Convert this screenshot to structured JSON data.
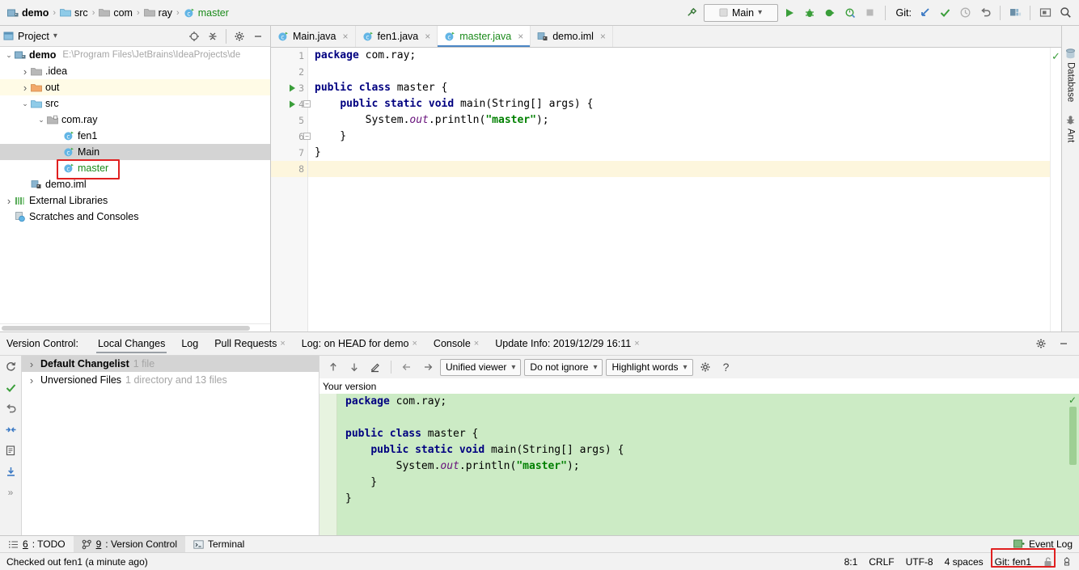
{
  "toolbar": {
    "breadcrumb": [
      {
        "label": "demo",
        "icon": "project-icon",
        "style": "bold"
      },
      {
        "label": "src",
        "icon": "folder-blue-icon",
        "style": "normal"
      },
      {
        "label": "com",
        "icon": "folder-gray-icon",
        "style": "normal"
      },
      {
        "label": "ray",
        "icon": "folder-gray-icon",
        "style": "normal"
      },
      {
        "label": "master",
        "icon": "java-class-icon",
        "style": "green"
      }
    ],
    "separator": "›",
    "run_config": "Main",
    "run_config_arrow": "⌄",
    "git_label": "Git:",
    "buttons": [
      "build-hammer-icon",
      "run-icon",
      "debug-icon",
      "run-coverage-icon",
      "profile-icon",
      "stop-icon",
      "git-update-icon",
      "git-commit-icon",
      "git-history-icon",
      "git-rollback-icon",
      "project-structure-icon",
      "present-mode-icon",
      "search-everywhere-icon"
    ]
  },
  "project_panel": {
    "title": "Project",
    "title_arrow": "▾",
    "tools": [
      "locate-icon",
      "collapse-all-icon",
      "settings-gear-icon",
      "hide-icon"
    ],
    "tree": [
      {
        "depth": 0,
        "twist": "⌄",
        "icon": "project-icon",
        "label": "demo",
        "style": "bold",
        "path": "E:\\Program Files\\JetBrains\\IdeaProjects\\de",
        "state": "normal"
      },
      {
        "depth": 1,
        "twist": "›",
        "icon": "folder-gray-icon",
        "label": ".idea",
        "style": "normal",
        "path": "",
        "state": "normal"
      },
      {
        "depth": 1,
        "twist": "›",
        "icon": "folder-orange-icon",
        "label": "out",
        "style": "normal",
        "path": "",
        "state": "band"
      },
      {
        "depth": 1,
        "twist": "⌄",
        "icon": "folder-blue-icon",
        "label": "src",
        "style": "normal",
        "path": "",
        "state": "normal"
      },
      {
        "depth": 2,
        "twist": "⌄",
        "icon": "package-icon",
        "label": "com.ray",
        "style": "normal",
        "path": "",
        "state": "normal"
      },
      {
        "depth": 3,
        "twist": "",
        "icon": "java-class-icon",
        "label": "fen1",
        "style": "normal",
        "path": "",
        "state": "normal"
      },
      {
        "depth": 3,
        "twist": "",
        "icon": "java-class-icon",
        "label": "Main",
        "style": "normal",
        "path": "",
        "state": "selected"
      },
      {
        "depth": 3,
        "twist": "",
        "icon": "java-class-icon",
        "label": "master",
        "style": "green",
        "path": "",
        "state": "highlighted"
      },
      {
        "depth": 1,
        "twist": "",
        "icon": "iml-file-icon",
        "label": "demo.iml",
        "style": "normal",
        "path": "",
        "state": "normal"
      },
      {
        "depth": 0,
        "twist": "›",
        "icon": "external-libraries-icon",
        "label": "External Libraries",
        "style": "normal",
        "path": "",
        "state": "normal"
      },
      {
        "depth": 0,
        "twist": "",
        "icon": "scratches-icon",
        "label": "Scratches and Consoles",
        "style": "normal",
        "path": "",
        "state": "normal"
      }
    ]
  },
  "editor_tabs": [
    {
      "label": "Main.java",
      "icon": "java-class-icon",
      "active": false,
      "color": "normal"
    },
    {
      "label": "fen1.java",
      "icon": "java-class-icon",
      "active": false,
      "color": "normal"
    },
    {
      "label": "master.java",
      "icon": "java-class-icon",
      "active": true,
      "color": "green"
    },
    {
      "label": "demo.iml",
      "icon": "iml-file-icon",
      "active": false,
      "color": "normal"
    }
  ],
  "editor_tab_close": "×",
  "editor": {
    "line_numbers": [
      "1",
      "2",
      "3",
      "4",
      "5",
      "6",
      "7",
      "8"
    ],
    "current_line": 8,
    "run_arrow_lines": [
      3,
      4
    ],
    "fold_lines": [
      4,
      6
    ],
    "lines": [
      [
        {
          "t": "package",
          "c": "kw"
        },
        {
          "t": " com.ray;",
          "c": ""
        }
      ],
      [
        {
          "t": "",
          "c": ""
        }
      ],
      [
        {
          "t": "public class",
          "c": "kw"
        },
        {
          "t": " master {",
          "c": ""
        }
      ],
      [
        {
          "t": "    ",
          "c": ""
        },
        {
          "t": "public static void",
          "c": "kw"
        },
        {
          "t": " main(String[] args) {",
          "c": ""
        }
      ],
      [
        {
          "t": "        System.",
          "c": ""
        },
        {
          "t": "out",
          "c": "fld"
        },
        {
          "t": ".println(",
          "c": ""
        },
        {
          "t": "\"master\"",
          "c": "str"
        },
        {
          "t": ");",
          "c": ""
        }
      ],
      [
        {
          "t": "    }",
          "c": ""
        }
      ],
      [
        {
          "t": "}",
          "c": ""
        }
      ],
      [
        {
          "t": "",
          "c": ""
        }
      ]
    ],
    "inspection_status": "✓"
  },
  "right_stripe": [
    {
      "label": "Database",
      "icon": "database-icon"
    },
    {
      "label": "Ant",
      "icon": "ant-icon"
    }
  ],
  "vcs": {
    "title": "Version Control:",
    "tabs": [
      {
        "label": "Local Changes",
        "active": true,
        "closable": false
      },
      {
        "label": "Log",
        "active": false,
        "closable": false
      },
      {
        "label": "Pull Requests",
        "active": false,
        "closable": true
      },
      {
        "label": "Log: on HEAD for demo",
        "active": false,
        "closable": true
      },
      {
        "label": "Console",
        "active": false,
        "closable": true
      },
      {
        "label": "Update Info: 2019/12/29 16:11",
        "active": false,
        "closable": true
      }
    ],
    "close_glyph": "×",
    "header_right": [
      "settings-gear-icon",
      "hide-icon"
    ],
    "side_icons": [
      "refresh-icon",
      "commit-icon",
      "rollback-icon",
      "shelve-icon",
      "show-diff-icon",
      "update-icon",
      "expand-more-icon"
    ],
    "expand_more": "»",
    "changelists": [
      {
        "twist": "›",
        "name": "Default Changelist",
        "meta": "1 file",
        "selected": true,
        "bold": true
      },
      {
        "twist": "›",
        "name": "Unversioned Files",
        "meta": "1 directory and 13 files",
        "selected": false,
        "bold": false
      }
    ],
    "diff_toolbar": {
      "buttons": [
        "prev-difference-icon",
        "next-difference-icon",
        "annotate-icon",
        "back-icon",
        "forward-icon"
      ],
      "selects": [
        {
          "value": "Unified viewer",
          "name": "viewer-select"
        },
        {
          "value": "Do not ignore",
          "name": "ignore-select"
        },
        {
          "value": "Highlight words",
          "name": "highlight-select"
        }
      ],
      "arrow": "⌄",
      "settings_icon": "settings-gear-icon",
      "help_icon": "?"
    },
    "your_version_label": "Your version",
    "diff_lines": [
      [
        {
          "t": "package",
          "c": "kw"
        },
        {
          "t": " com.ray;",
          "c": ""
        }
      ],
      [
        {
          "t": "",
          "c": ""
        }
      ],
      [
        {
          "t": "public class",
          "c": "kw"
        },
        {
          "t": " master {",
          "c": ""
        }
      ],
      [
        {
          "t": "    ",
          "c": ""
        },
        {
          "t": "public static void",
          "c": "kw"
        },
        {
          "t": " main(String[] args) {",
          "c": ""
        }
      ],
      [
        {
          "t": "        System.",
          "c": ""
        },
        {
          "t": "out",
          "c": "fld"
        },
        {
          "t": ".println(",
          "c": ""
        },
        {
          "t": "\"master\"",
          "c": "str"
        },
        {
          "t": ");",
          "c": ""
        }
      ],
      [
        {
          "t": "    }",
          "c": ""
        }
      ],
      [
        {
          "t": "}",
          "c": ""
        }
      ]
    ],
    "diff_ok": "✓"
  },
  "bottom_bar": {
    "items": [
      {
        "num": "6",
        "label": ": TODO",
        "icon": "todo-icon",
        "active": false
      },
      {
        "num": "9",
        "label": ": Version Control",
        "icon": "version-control-icon",
        "active": true
      },
      {
        "num": "",
        "label": "Terminal",
        "icon": "terminal-icon",
        "active": false
      }
    ],
    "event_log": "Event Log",
    "event_log_icon": "event-log-icon"
  },
  "status_bar": {
    "message": "Checked out fen1 (a minute ago)",
    "caret": "8:1",
    "line_separator": "CRLF",
    "encoding": "UTF-8",
    "indent": "4 spaces",
    "git_branch": "Git: fen1",
    "lock_icon": "unlock-icon",
    "inspection_icon": "inspection-icon"
  },
  "annotations": {
    "color": "#e02020"
  }
}
